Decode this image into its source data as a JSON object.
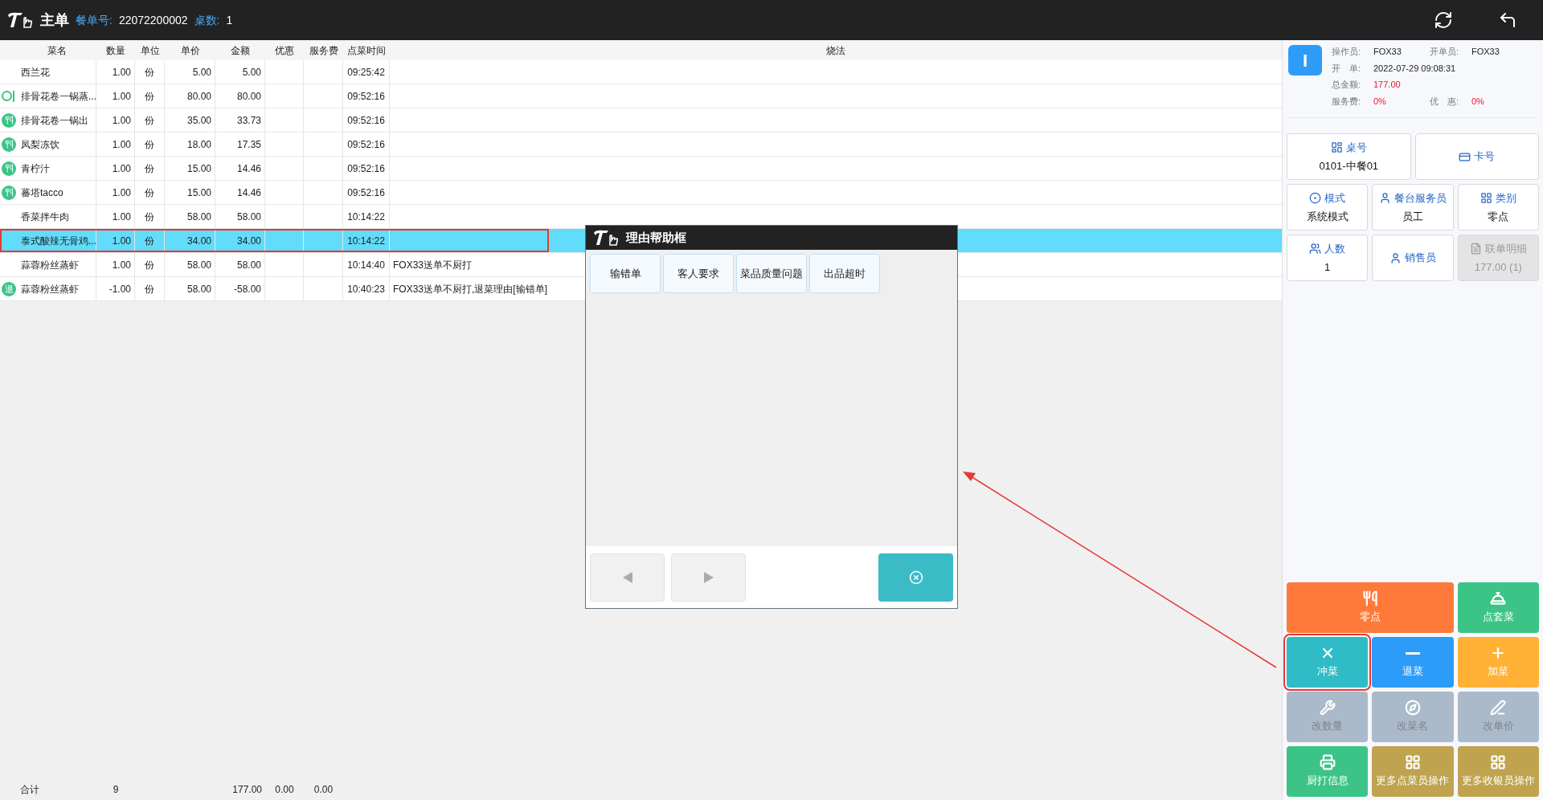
{
  "header": {
    "title": "主单",
    "order_label": "餐单号:",
    "order_no": "22072200002",
    "tables_label": "桌数:",
    "tables": "1"
  },
  "table": {
    "columns": [
      "菜名",
      "数量",
      "单位",
      "单价",
      "金额",
      "优惠",
      "服务费",
      "点菜时间",
      "烧法"
    ],
    "rows": [
      {
        "kind": "plain",
        "name": "西兰花",
        "qty": "1.00",
        "unit": "份",
        "price": "5.00",
        "amount": "5.00",
        "discount": "",
        "service": "",
        "time": "09:25:42",
        "method": "",
        "selected": false
      },
      {
        "kind": "pending",
        "name": "排骨花卷一锅蒸...",
        "qty": "1.00",
        "unit": "份",
        "price": "80.00",
        "amount": "80.00",
        "discount": "",
        "service": "",
        "time": "09:52:16",
        "method": "",
        "selected": false
      },
      {
        "kind": "served",
        "name": "排骨花卷一锅出",
        "qty": "1.00",
        "unit": "份",
        "price": "35.00",
        "amount": "33.73",
        "discount": "",
        "service": "",
        "time": "09:52:16",
        "method": "",
        "selected": false
      },
      {
        "kind": "served",
        "name": "凤梨冻饮",
        "qty": "1.00",
        "unit": "份",
        "price": "18.00",
        "amount": "17.35",
        "discount": "",
        "service": "",
        "time": "09:52:16",
        "method": "",
        "selected": false
      },
      {
        "kind": "served",
        "name": "青柠汁",
        "qty": "1.00",
        "unit": "份",
        "price": "15.00",
        "amount": "14.46",
        "discount": "",
        "service": "",
        "time": "09:52:16",
        "method": "",
        "selected": false
      },
      {
        "kind": "served",
        "name": "蕃塔tacco",
        "qty": "1.00",
        "unit": "份",
        "price": "15.00",
        "amount": "14.46",
        "discount": "",
        "service": "",
        "time": "09:52:16",
        "method": "",
        "selected": false
      },
      {
        "kind": "plain",
        "name": "香菜拌牛肉",
        "qty": "1.00",
        "unit": "份",
        "price": "58.00",
        "amount": "58.00",
        "discount": "",
        "service": "",
        "time": "10:14:22",
        "method": "",
        "selected": false
      },
      {
        "kind": "plain",
        "name": "泰式酸辣无骨鸡...",
        "qty": "1.00",
        "unit": "份",
        "price": "34.00",
        "amount": "34.00",
        "discount": "",
        "service": "",
        "time": "10:14:22",
        "method": "",
        "selected": true
      },
      {
        "kind": "plain",
        "name": "蒜蓉粉丝蒸虾",
        "qty": "1.00",
        "unit": "份",
        "price": "58.00",
        "amount": "58.00",
        "discount": "",
        "service": "",
        "time": "10:14:40",
        "method": "FOX33送单不厨打",
        "selected": false
      },
      {
        "kind": "returned",
        "badge": "退",
        "name": "蒜蓉粉丝蒸虾",
        "qty": "-1.00",
        "unit": "份",
        "price": "58.00",
        "amount": "-58.00",
        "discount": "",
        "service": "",
        "time": "10:40:23",
        "method": "FOX33送单不厨打,退菜理由[输错单]",
        "selected": false
      }
    ],
    "totals": {
      "label": "合计",
      "qty": "9",
      "amount": "177.00",
      "discount": "0.00",
      "service": "0.00"
    }
  },
  "info": {
    "badge": "I",
    "operator_label": "操作员:",
    "operator": "FOX33",
    "opener_label": "开单员:",
    "opener": "FOX33",
    "open_label": "开　单:",
    "open_time": "2022-07-29 09:08:31",
    "total_label": "总金额:",
    "total": "177.00",
    "service_label": "服务费:",
    "service": "0%",
    "discount_label": "优　惠:",
    "discount": "0%"
  },
  "info_buttons": [
    {
      "label": "桌号",
      "value": "0101-中餐01",
      "disabled": false,
      "wide": true
    },
    {
      "label": "卡号",
      "disabled": false,
      "wide": true
    },
    {
      "label": "模式",
      "value": "系统模式",
      "disabled": false,
      "wide": false
    },
    {
      "label": "餐台服务员",
      "value": "员工",
      "disabled": false,
      "wide": false
    },
    {
      "label": "类别",
      "value": "零点",
      "disabled": false,
      "wide": false
    },
    {
      "label": "人数",
      "value": "1",
      "disabled": false,
      "wide": false
    },
    {
      "label": "销售员",
      "disabled": false,
      "wide": false
    },
    {
      "label": "联单明细",
      "value": "177.00 (1)",
      "disabled": true,
      "wide": false
    }
  ],
  "actions": [
    {
      "label": "零点",
      "color": "#ff7a3a",
      "disabled": false,
      "wide": true,
      "highlighted": false
    },
    {
      "label": "点套菜",
      "color": "#3cc486",
      "disabled": false,
      "wide": false,
      "highlighted": false
    },
    {
      "label": "冲菜",
      "color": "#2fbcc6",
      "disabled": false,
      "wide": false,
      "highlighted": true
    },
    {
      "label": "退菜",
      "color": "#2d9cf8",
      "disabled": false,
      "wide": false,
      "highlighted": false
    },
    {
      "label": "加菜",
      "color": "#ffb136",
      "disabled": false,
      "wide": false,
      "highlighted": false
    },
    {
      "label": "改数量",
      "color": "#abbaca",
      "disabled": true,
      "wide": false,
      "highlighted": false
    },
    {
      "label": "改菜名",
      "color": "#abbaca",
      "disabled": true,
      "wide": false,
      "highlighted": false
    },
    {
      "label": "改单价",
      "color": "#abbaca",
      "disabled": true,
      "wide": false,
      "highlighted": false
    },
    {
      "label": "厨打信息",
      "color": "#3cc486",
      "disabled": false,
      "wide": false,
      "highlighted": false
    },
    {
      "label": "更多点菜员操作",
      "color": "#bfa34e",
      "disabled": false,
      "wide": false,
      "highlighted": false
    },
    {
      "label": "更多收银员操作",
      "color": "#bfa34e",
      "disabled": false,
      "wide": false,
      "highlighted": false
    }
  ],
  "dialog": {
    "title": "理由帮助框",
    "reasons": [
      "输错单",
      "客人要求",
      "菜品质量问题",
      "出品超时"
    ]
  }
}
